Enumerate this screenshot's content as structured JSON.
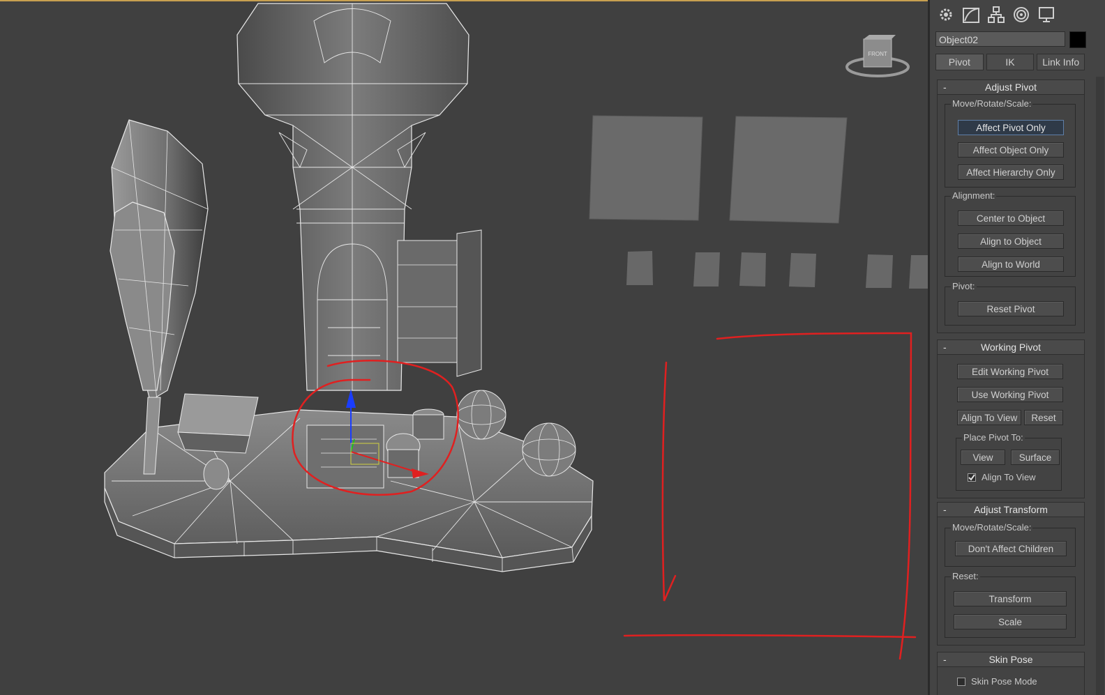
{
  "viewport": {
    "viewcube_label": "FRONT",
    "colors": {
      "background": "#404040",
      "mesh_face": "#7a7a7a",
      "wire": "#e8e8e8",
      "annotation": "#e02020"
    }
  },
  "panel": {
    "tab_icons": [
      "create-icon",
      "modify-icon",
      "hierarchy-icon",
      "motion-icon",
      "display-icon"
    ],
    "object_name": "Object02",
    "subtabs": [
      "Pivot",
      "IK",
      "Link Info"
    ],
    "adjust_pivot": {
      "title": "Adjust Pivot",
      "move_rotate_scale_label": "Move/Rotate/Scale:",
      "affect_pivot_only": "Affect Pivot Only",
      "affect_object_only": "Affect Object Only",
      "affect_hierarchy_only": "Affect Hierarchy Only",
      "alignment_label": "Alignment:",
      "center_to_object": "Center to Object",
      "align_to_object": "Align to Object",
      "align_to_world": "Align to World",
      "pivot_label": "Pivot:",
      "reset_pivot": "Reset Pivot"
    },
    "working_pivot": {
      "title": "Working Pivot",
      "edit_working_pivot": "Edit Working Pivot",
      "use_working_pivot": "Use Working Pivot",
      "align_to_view": "Align To View",
      "reset": "Reset",
      "place_pivot_to_label": "Place Pivot To:",
      "view": "View",
      "surface": "Surface",
      "align_to_view_check": "Align To View",
      "align_to_view_checked": true
    },
    "adjust_transform": {
      "title": "Adjust Transform",
      "move_rotate_scale_label": "Move/Rotate/Scale:",
      "dont_affect_children": "Don't Affect Children",
      "reset_label": "Reset:",
      "transform": "Transform",
      "scale": "Scale"
    },
    "skin_pose": {
      "title": "Skin Pose",
      "skin_pose_mode": "Skin Pose Mode"
    }
  }
}
